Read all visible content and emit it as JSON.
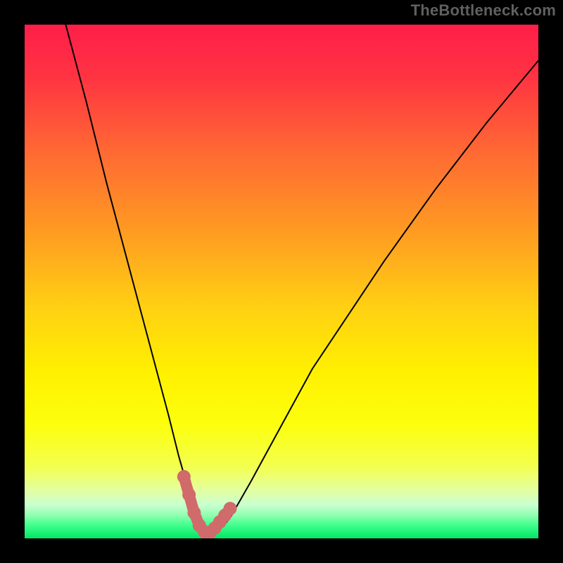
{
  "watermark": "TheBottleneck.com",
  "colors": {
    "frame": "#000000",
    "curve": "#000000",
    "marker": "#d16a6a",
    "gradient_stops": [
      {
        "offset": 0.0,
        "color": "#ff1e49"
      },
      {
        "offset": 0.1,
        "color": "#ff3342"
      },
      {
        "offset": 0.25,
        "color": "#ff6a33"
      },
      {
        "offset": 0.4,
        "color": "#ff9a22"
      },
      {
        "offset": 0.55,
        "color": "#ffd013"
      },
      {
        "offset": 0.68,
        "color": "#fff100"
      },
      {
        "offset": 0.78,
        "color": "#fcff0e"
      },
      {
        "offset": 0.86,
        "color": "#f3ff4f"
      },
      {
        "offset": 0.905,
        "color": "#e4ff9f"
      },
      {
        "offset": 0.935,
        "color": "#c9ffd0"
      },
      {
        "offset": 0.955,
        "color": "#8fffb0"
      },
      {
        "offset": 0.975,
        "color": "#3eff8c"
      },
      {
        "offset": 1.0,
        "color": "#00e765"
      }
    ]
  },
  "chart_data": {
    "type": "line",
    "title": "",
    "xlabel": "",
    "ylabel": "",
    "xlim": [
      0,
      100
    ],
    "ylim": [
      0,
      100
    ],
    "grid": false,
    "legend": false,
    "series": [
      {
        "name": "bottleneck-curve",
        "x": [
          8,
          12,
          16,
          20,
          24,
          28,
          30,
          32,
          33.5,
          35,
          36.5,
          38,
          40,
          44,
          50,
          56,
          62,
          70,
          80,
          90,
          100
        ],
        "values": [
          100,
          85,
          69,
          54,
          39,
          24,
          16,
          9,
          4,
          1.7,
          0.8,
          1.7,
          4,
          11,
          22,
          33,
          42,
          54,
          68,
          81,
          93
        ]
      }
    ],
    "markers": {
      "name": "highlight-markers",
      "x": [
        31,
        32,
        33,
        34,
        35,
        35.5,
        36,
        37,
        38,
        39,
        40
      ],
      "values": [
        12,
        8.5,
        5,
        2.5,
        1.3,
        0.9,
        1.0,
        2.0,
        3.2,
        4.5,
        5.8
      ]
    },
    "annotations": []
  }
}
